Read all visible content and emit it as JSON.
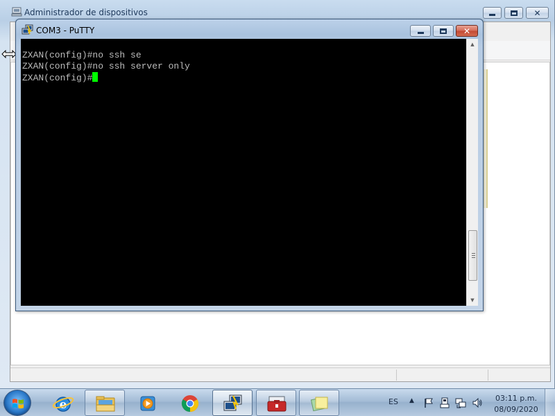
{
  "device_manager": {
    "title": "Administrador de dispositivos",
    "controls": {
      "minimize": "minimize",
      "maximize": "maximize",
      "close": "close"
    }
  },
  "putty": {
    "title": "COM3 - PuTTY",
    "terminal": {
      "lines": [
        "ZXAN(config)#no ssh se",
        "ZXAN(config)#no ssh server only"
      ],
      "prompt": "ZXAN(config)#",
      "cursor_color": "#00ff00",
      "background": "#000000",
      "foreground": "#bbbbbb"
    },
    "scrollbar": {
      "position": 0.93
    }
  },
  "taskbar": {
    "start": "start-button",
    "items": [
      {
        "name": "internet-explorer",
        "icon": "internet-explorer-icon",
        "state": "pinned"
      },
      {
        "name": "windows-explorer",
        "icon": "folder-icon",
        "state": "running"
      },
      {
        "name": "media-player",
        "icon": "media-player-icon",
        "state": "pinned"
      },
      {
        "name": "chrome",
        "icon": "chrome-icon",
        "state": "pinned"
      },
      {
        "name": "putty",
        "icon": "putty-icon",
        "state": "active"
      },
      {
        "name": "control-panel",
        "icon": "toolbox-icon",
        "state": "running"
      },
      {
        "name": "sticky-notes",
        "icon": "sticky-notes-icon",
        "state": "running"
      }
    ],
    "tray": {
      "language": "ES",
      "expand": "▲",
      "icons": [
        "flag-icon",
        "usb-device-icon",
        "network-icon",
        "volume-icon"
      ],
      "time": "03:11 p.m.",
      "date": "08/09/2020"
    }
  },
  "colors": {
    "aero_title": "#b9cfe6",
    "close_red": "#c44b35",
    "terminal_text": "#bbbbbb"
  }
}
